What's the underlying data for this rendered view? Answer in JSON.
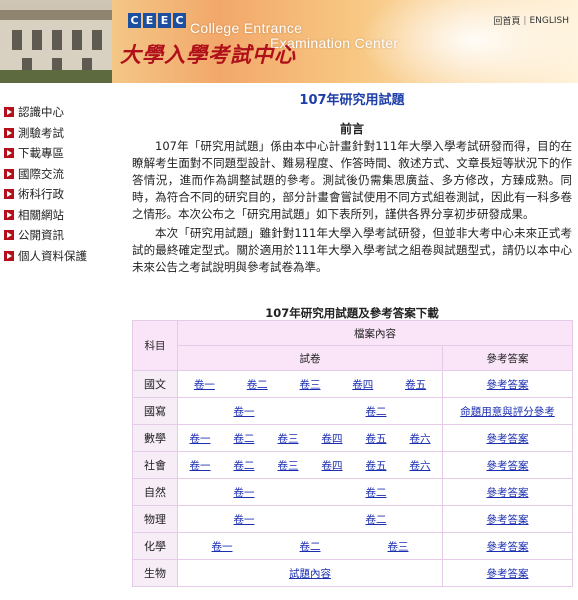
{
  "header": {
    "logo_letters": [
      "C",
      "E",
      "E",
      "C"
    ],
    "name_en_line1": "College Entrance",
    "name_en_line2": "Examination Center",
    "name_zh": "大學入學考試中心",
    "links": {
      "home": "回首頁",
      "english": "ENGLISH"
    }
  },
  "sidebar": {
    "items": [
      {
        "label": "認識中心"
      },
      {
        "label": "測驗考試"
      },
      {
        "label": "下載專區"
      },
      {
        "label": "國際交流"
      },
      {
        "label": "術科行政"
      },
      {
        "label": "相關網站"
      },
      {
        "label": "公開資訊"
      },
      {
        "label": "個人資料保護"
      }
    ]
  },
  "main": {
    "title": "107年研究用試題",
    "preface_heading": "前言",
    "paragraph_1": "107年「研究用試題」係由本中心計畫針對111年大學入學考試研發而得，目的在瞭解考生面對不同題型設計、難易程度、作答時間、敘述方式、文章長短等狀況下的作答情況，進而作為調整試題的參考。測試後仍需集思廣益、多方修改，方臻成熟。同時，為符合不同的研究目的，部分計畫會嘗試使用不同方式組卷測試，因此有一科多卷之情形。本次公布之「研究用試題」如下表所列，謹供各界分享初步研發成果。",
    "paragraph_2": "本次「研究用試題」雖針對111年大學入學考試研發，但並非大考中心未來正式考試的最終確定型式。關於適用於111年大學入學考試之組卷與試題型式，請仍以本中心未來公告之考試說明與參考試卷為準。"
  },
  "table": {
    "title": "107年研究用試題及參考答案下載",
    "header": {
      "subject": "科目",
      "file_content": "檔案內容",
      "papers": "試卷",
      "answers": "參考答案"
    },
    "rows": [
      {
        "subject": "國文",
        "papers": [
          "卷一",
          "卷二",
          "卷三",
          "卷四",
          "卷五"
        ],
        "answer": "參考答案"
      },
      {
        "subject": "國寫",
        "papers": [
          "卷一",
          "卷二"
        ],
        "answer": "命題用意與評分參考"
      },
      {
        "subject": "數學",
        "papers": [
          "卷一",
          "卷二",
          "卷三",
          "卷四",
          "卷五",
          "卷六"
        ],
        "answer": "參考答案"
      },
      {
        "subject": "社會",
        "papers": [
          "卷一",
          "卷二",
          "卷三",
          "卷四",
          "卷五",
          "卷六"
        ],
        "answer": "參考答案"
      },
      {
        "subject": "自然",
        "papers": [
          "卷一",
          "卷二"
        ],
        "answer": "參考答案"
      },
      {
        "subject": "物理",
        "papers": [
          "卷一",
          "卷二"
        ],
        "answer": "參考答案"
      },
      {
        "subject": "化學",
        "papers": [
          "卷一",
          "卷二",
          "卷三"
        ],
        "answer": "參考答案"
      },
      {
        "subject": "生物",
        "papers": [
          "試題內容"
        ],
        "answer": "參考答案"
      }
    ]
  },
  "colors": {
    "title_blue": "#1f3fa8",
    "link_blue": "#1c2fb0",
    "nav_arrow_red": "#b3101c",
    "table_header_pink": "#f9e4f8",
    "table_border": "#e6cbe8"
  }
}
